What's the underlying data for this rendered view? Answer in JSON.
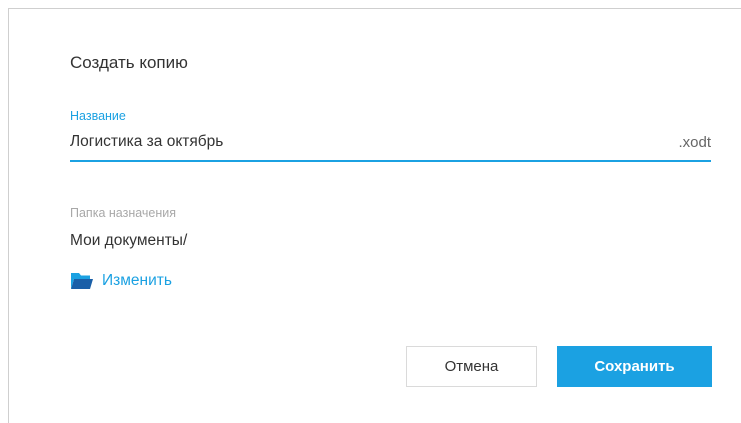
{
  "dialog": {
    "title": "Создать копию",
    "name_field": {
      "label": "Название",
      "value": "Логистика за октябрь",
      "extension": ".xodt"
    },
    "destination": {
      "label": "Папка назначения",
      "path": "Мои документы/",
      "change_label": "Изменить"
    },
    "buttons": {
      "cancel_label": "Отмена",
      "save_label": "Сохранить"
    }
  },
  "icons": {
    "change": "folder-icon"
  },
  "colors": {
    "accent": "#1ba1e2",
    "text": "#333333",
    "muted": "#a8a8a8"
  }
}
